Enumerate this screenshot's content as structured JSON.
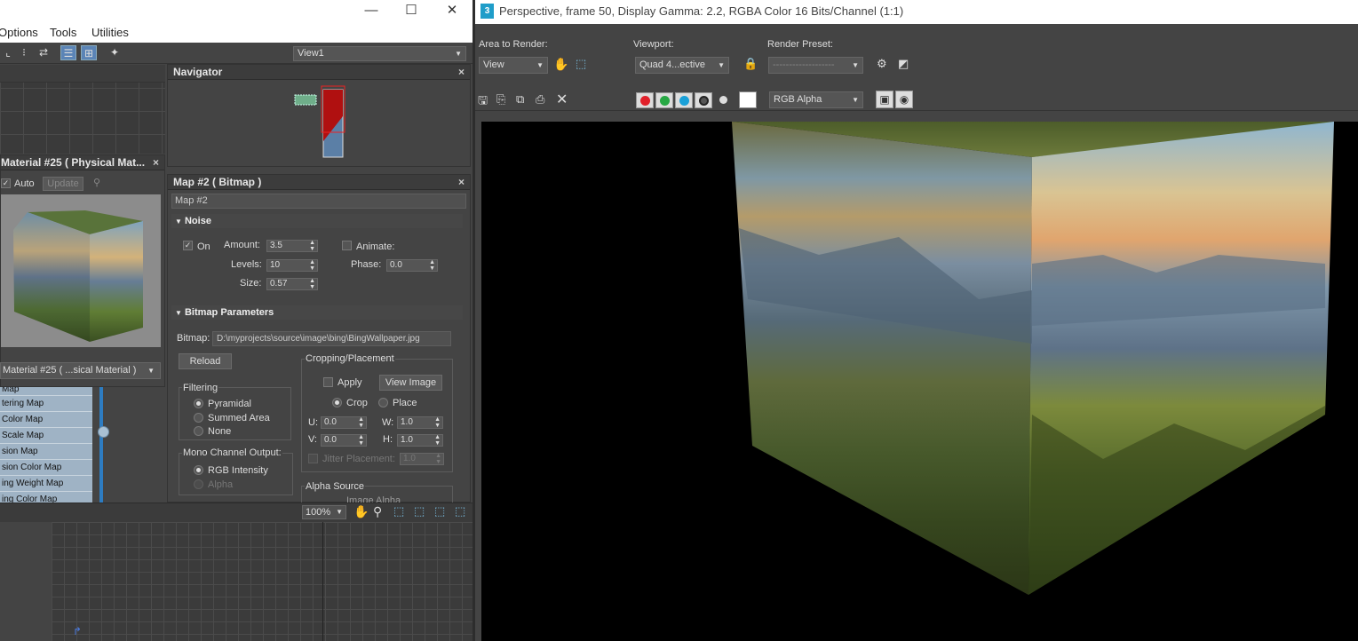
{
  "left_window": {
    "menu": [
      "Options",
      "Tools",
      "Utilities"
    ],
    "view_select": "View1",
    "zoom": "100%"
  },
  "navigator": {
    "title": "Navigator"
  },
  "material": {
    "title": "Material #25  ( Physical Mat...",
    "auto_label": "Auto",
    "auto_checked": true,
    "update_label": "Update",
    "select_value": "Material #25  ( ...sical Material )"
  },
  "map_list": [
    "Map",
    "tering Map",
    " Color Map",
    " Scale Map",
    "sion Map",
    "sion Color Map",
    "ing Weight Map",
    "ing Color Map"
  ],
  "map_panel": {
    "title": "Map #2  ( Bitmap )",
    "name": "Map #2",
    "noise": {
      "title": "Noise",
      "on_label": "On",
      "on_checked": true,
      "amount_label": "Amount:",
      "amount": "3.5",
      "levels_label": "Levels:",
      "levels": "10",
      "size_label": "Size:",
      "size": "0.57",
      "animate_label": "Animate:",
      "animate_checked": false,
      "phase_label": "Phase:",
      "phase": "0.0"
    },
    "bitmap": {
      "title": "Bitmap Parameters",
      "bitmap_label": "Bitmap:",
      "path": "D:\\myprojects\\source\\image\\bing\\BingWallpaper.jpg",
      "reload_label": "Reload",
      "filtering_label": "Filtering",
      "filtering_options": [
        "Pyramidal",
        "Summed Area",
        "None"
      ],
      "filtering_selected": "Pyramidal",
      "mono_label": "Mono Channel Output:",
      "mono_options": [
        "RGB Intensity",
        "Alpha"
      ],
      "mono_selected": "RGB Intensity",
      "cropping_label": "Cropping/Placement",
      "apply_label": "Apply",
      "view_image_label": "View Image",
      "crop_label": "Crop",
      "place_label": "Place",
      "crop_mode": "Crop",
      "u_label": "U:",
      "u": "0.0",
      "v_label": "V:",
      "v": "0.0",
      "w_label": "W:",
      "w": "1.0",
      "h_label": "H:",
      "h": "1.0",
      "jitter_label": "Jitter Placement:",
      "jitter": "1.0",
      "alpha_source_label": "Alpha Source",
      "alpha_source_value": "Image Alpha"
    }
  },
  "render": {
    "title": "Perspective, frame 50, Display Gamma: 2.2, RGBA Color 16 Bits/Channel (1:1)",
    "area_label": "Area to Render:",
    "area_value": "View",
    "viewport_label": "Viewport:",
    "viewport_value": "Quad 4...ective",
    "preset_label": "Render Preset:",
    "preset_value": "-------------------",
    "channel_value": "RGB Alpha",
    "channel_colors": [
      "#e0202a",
      "#27a844",
      "#19a0d8"
    ]
  }
}
